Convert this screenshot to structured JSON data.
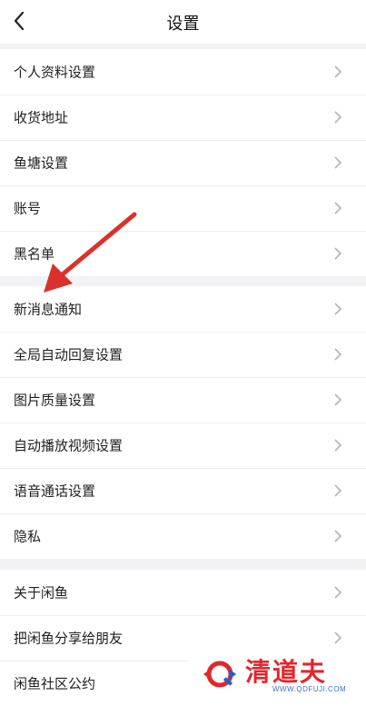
{
  "header": {
    "title": "设置"
  },
  "groups": [
    {
      "items": [
        {
          "label": "个人资料设置"
        },
        {
          "label": "收货地址"
        },
        {
          "label": "鱼塘设置"
        },
        {
          "label": "账号"
        },
        {
          "label": "黑名单"
        }
      ]
    },
    {
      "items": [
        {
          "label": "新消息通知"
        },
        {
          "label": "全局自动回复设置"
        },
        {
          "label": "图片质量设置"
        },
        {
          "label": "自动播放视频设置"
        },
        {
          "label": "语音通话设置"
        },
        {
          "label": "隐私"
        }
      ]
    },
    {
      "items": [
        {
          "label": "关于闲鱼"
        },
        {
          "label": "把闲鱼分享给朋友"
        },
        {
          "label": "闲鱼社区公约"
        }
      ]
    }
  ],
  "icons": {
    "back": "chevron-left-icon",
    "row": "chevron-right-icon"
  },
  "watermark": {
    "name": "清道夫",
    "url": "WWW.QDFUJI.COM"
  },
  "colors": {
    "arrow": "#d9322c",
    "watermark": "#e3262b",
    "chevron": "#b4b4b4"
  }
}
